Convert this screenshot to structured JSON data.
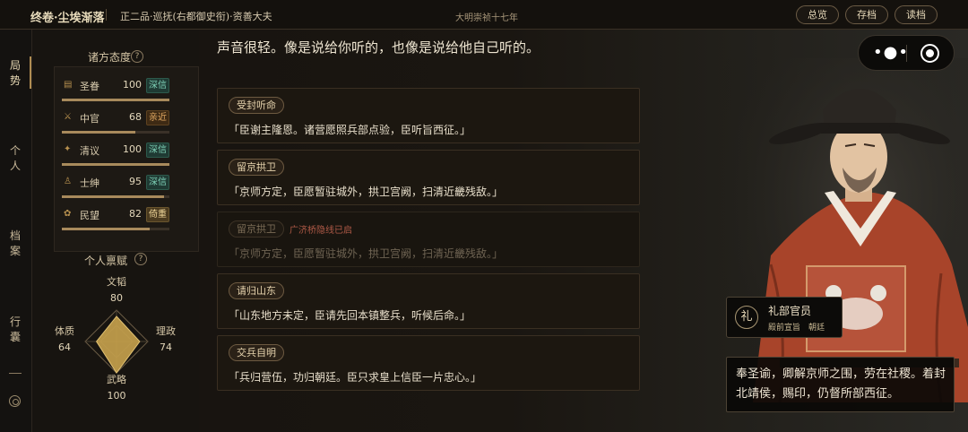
{
  "topbar": {
    "title": "终卷·尘埃渐落",
    "rank": "正二品·巡抚(右都御史衔)·资善大夫",
    "era": "大明崇祯十七年",
    "buttons": [
      "总览",
      "存档",
      "读档"
    ]
  },
  "leftnav": {
    "items": [
      "局势",
      "个人",
      "档案",
      "行囊"
    ]
  },
  "attitudes": {
    "title": "诸方态度",
    "help": "?",
    "rows": [
      {
        "icon": "▤",
        "name": "圣眷",
        "value": "100",
        "badge": "深信",
        "level": 1.0,
        "kind": "trust"
      },
      {
        "icon": "⚔",
        "name": "中官",
        "value": "68",
        "badge": "亲近",
        "level": 0.68,
        "kind": "near"
      },
      {
        "icon": "✦",
        "name": "清议",
        "value": "100",
        "badge": "深信",
        "level": 1.0,
        "kind": "trust"
      },
      {
        "icon": "♙",
        "name": "士绅",
        "value": "95",
        "badge": "深信",
        "level": 0.95,
        "kind": "trust"
      },
      {
        "icon": "✿",
        "name": "民望",
        "value": "82",
        "badge": "倚重",
        "level": 0.82,
        "kind": "rely"
      }
    ]
  },
  "talents": {
    "title": "个人禀赋",
    "help": "?",
    "top": {
      "label": "文韬",
      "value": "80"
    },
    "left": {
      "label": "体质",
      "value": "64"
    },
    "right": {
      "label": "理政",
      "value": "74"
    },
    "bottom": {
      "label": "武略",
      "value": "100"
    }
  },
  "main": {
    "narration": "声音很轻。像是说给你听的，也像是说给他自己听的。",
    "choices": [
      {
        "tag": "受封听命",
        "lock": "",
        "text": "「臣谢主隆恩。诸营愿照兵部点验，臣听旨西征。」",
        "dim": false
      },
      {
        "tag": "留京拱卫",
        "lock": "",
        "text": "「京师方定，臣愿暂驻城外，拱卫宫阙，扫清近畿残敌。」",
        "dim": false
      },
      {
        "tag": "留京拱卫",
        "lock": "广济桥隐线已启",
        "text": "「京师方定，臣愿暂驻城外，拱卫宫阙，扫清近畿残敌。」",
        "dim": true
      },
      {
        "tag": "请归山东",
        "lock": "",
        "text": "「山东地方未定，臣请先回本镇整兵，听候后命。」",
        "dim": false
      },
      {
        "tag": "交兵自明",
        "lock": "",
        "text": "「兵归营伍，功归朝廷。臣只求皇上信臣一片忠心。」",
        "dim": false
      }
    ]
  },
  "speaker": {
    "seal": "礼",
    "title": "礼部官员",
    "subtitle": "殿前宣旨　朝廷"
  },
  "dialog": {
    "text": "奉圣谕，卿解京师之围，劳在社稷。着封北靖侯，赐印，仍督所部西征。"
  }
}
